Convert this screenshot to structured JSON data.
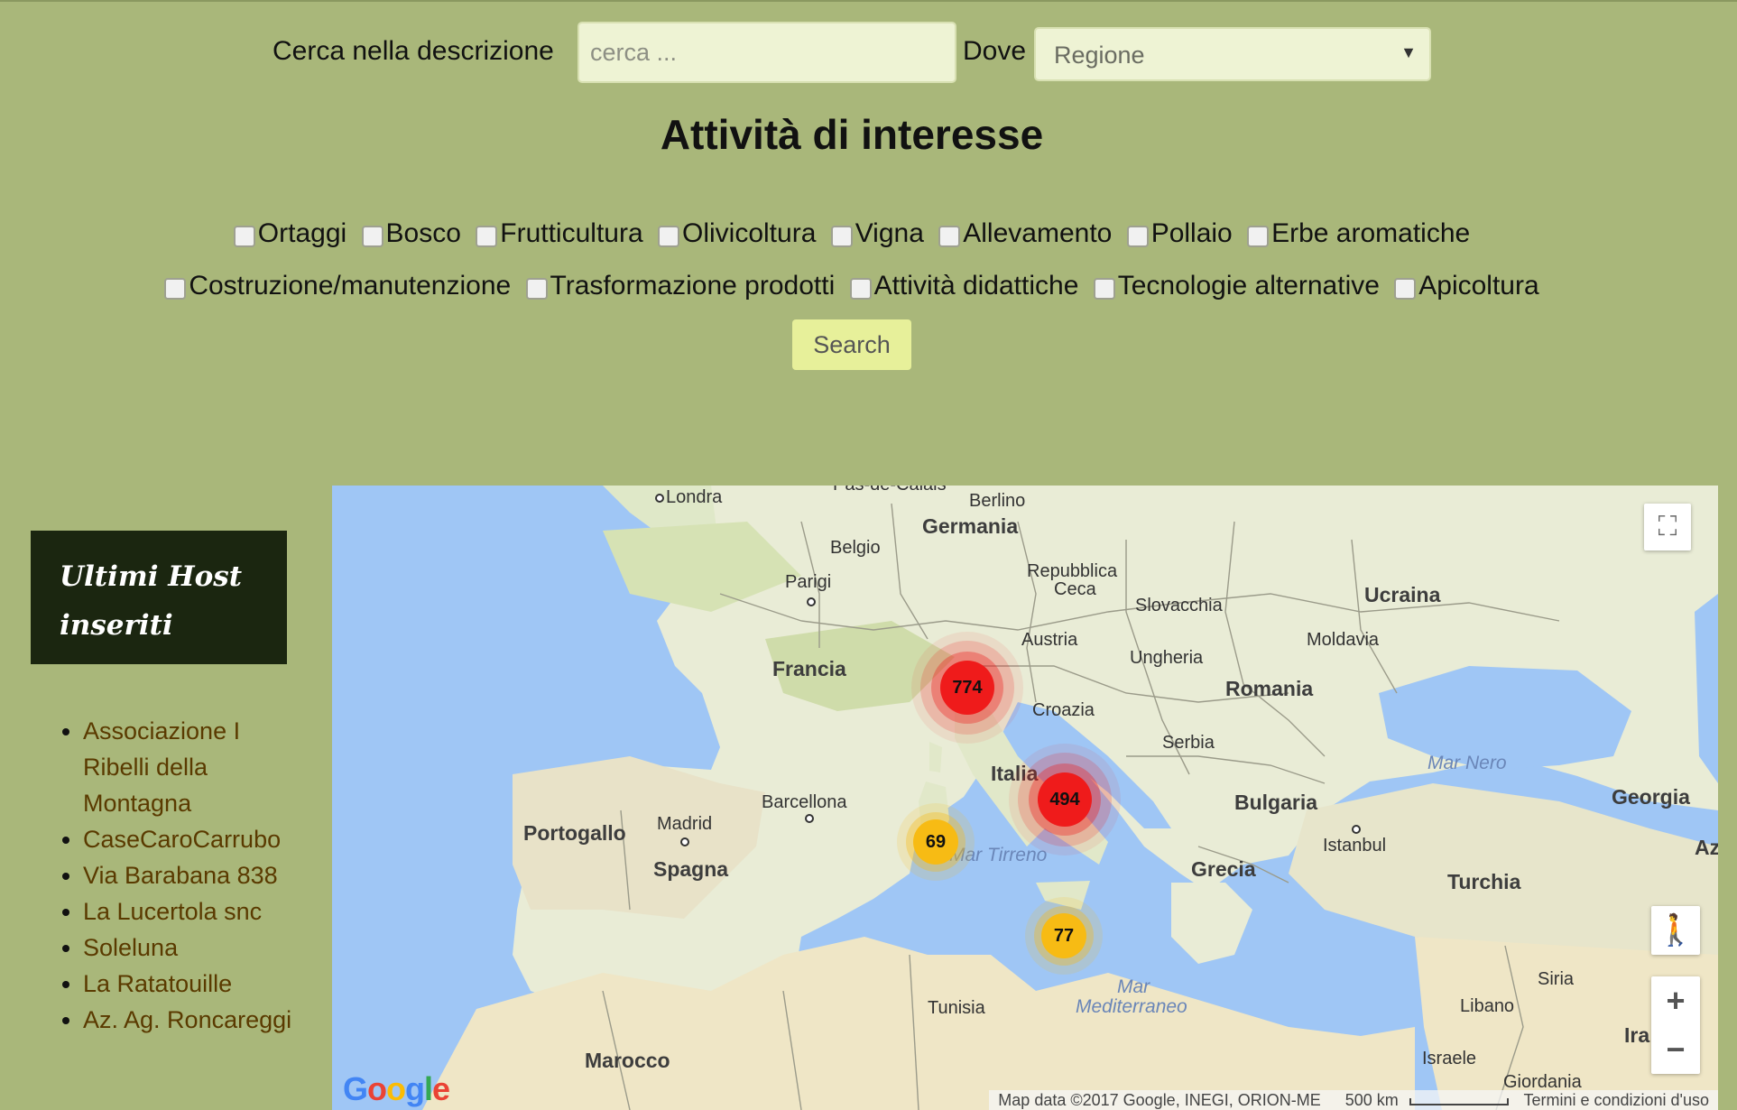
{
  "search": {
    "label": "Cerca nella descrizione",
    "placeholder": "cerca ...",
    "where_label": "Dove",
    "region_value": "Regione",
    "region_caret": "▼"
  },
  "heading": "Attività di interesse",
  "activities_row1": [
    "Ortaggi",
    "Bosco",
    "Frutticultura",
    "Olivicoltura",
    "Vigna",
    "Allevamento",
    "Pollaio",
    "Erbe aromatiche"
  ],
  "activities_row2": [
    "Costruzione/manutenzione",
    "Trasformazione prodotti",
    "Attività didattiche",
    "Tecnologie alternative",
    "Apicoltura"
  ],
  "search_button": "Search",
  "sidebar": {
    "title_line1": "Ultimi Host",
    "title_line2": "inseriti",
    "hosts": [
      "Associazione I Ribelli della Montagna",
      "CaseCaroCarrubo",
      "Via Barabana 838",
      "La Lucertola snc",
      "Soleluna",
      "La Ratatouille",
      "Az. Ag. Roncareggi"
    ]
  },
  "map": {
    "labels": {
      "londra": "Londra",
      "berlino": "Berlino",
      "germania": "Germania",
      "belgio": "Belgio",
      "parigi": "Parigi",
      "repubblica1": "Repubblica",
      "repubblica2": "Ceca",
      "slovacchia": "Slovacchia",
      "ucraina": "Ucraina",
      "francia": "Francia",
      "austria": "Austria",
      "moldavia": "Moldavia",
      "ungheria": "Ungheria",
      "romania": "Romania",
      "croazia": "Croazia",
      "serbia": "Serbia",
      "italia": "Italia",
      "mar_nero": "Mar Nero",
      "georgia": "Georgia",
      "barcellona": "Barcellona",
      "bulgaria": "Bulgaria",
      "portogallo": "Portogallo",
      "madrid": "Madrid",
      "spagna": "Spagna",
      "mar_tirreno": "Mar Tirreno",
      "istanbul": "Istanbul",
      "grecia": "Grecia",
      "turchia": "Turchia",
      "az": "Az",
      "siria": "Siria",
      "libano": "Libano",
      "tunisia": "Tunisia",
      "mar": "Mar",
      "mediterraneo": "Mediterraneo",
      "ira": "Ira",
      "israele": "Israele",
      "giordania": "Giordania",
      "marocco": "Marocco",
      "pas": "Pas-de-Calais"
    },
    "clusters": {
      "north_italy": "774",
      "rome": "494",
      "sardinia": "69",
      "sicily": "77"
    },
    "controls": {
      "fullscreen": "⛶",
      "pegman": "🚶",
      "zoom_in": "+",
      "zoom_out": "−"
    },
    "google": "Google",
    "attribution": {
      "data": "Map data ©2017 Google, INEGI, ORION-ME",
      "scale": "500 km",
      "terms": "Termini e condizioni d'uso"
    }
  },
  "colors": {
    "page_bg": "#a9b77a",
    "sidebar_box": "#1b2610",
    "cluster_red": "#ef1b1b",
    "cluster_yellow": "#f7bb14",
    "sea": "#9fc6f5",
    "land": "#e9ecd6"
  }
}
